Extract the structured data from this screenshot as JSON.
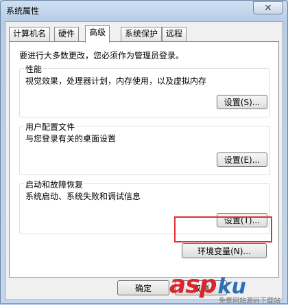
{
  "window": {
    "title": "系统属性",
    "close_glyph": "✕"
  },
  "tabs": [
    {
      "label": "计算机名",
      "active": false
    },
    {
      "label": "硬件",
      "active": false
    },
    {
      "label": "高级",
      "active": true
    },
    {
      "label": "系统保护",
      "active": false
    },
    {
      "label": "远程",
      "active": false
    }
  ],
  "admin_note": "要进行大多数更改，您必须作为管理员登录。",
  "groups": {
    "performance": {
      "title": "性能",
      "description": "视觉效果，处理器计划，内存使用，以及虚拟内存",
      "button": "设置(S)..."
    },
    "user_profiles": {
      "title": "用户配置文件",
      "description": "与您登录有关的桌面设置",
      "button": "设置(E)..."
    },
    "startup_recovery": {
      "title": "启动和故障恢复",
      "description": "系统启动、系统失败和调试信息",
      "button": "设置(T)..."
    }
  },
  "env_button": "环境变量(N)...",
  "footer": {
    "ok": "确定",
    "cancel": "取消"
  },
  "highlight_color": "#e0322d",
  "watermark": {
    "asp": "asp",
    "ku": "ku",
    "dotcom": ".com",
    "sub": "免费网站源码下载站"
  }
}
